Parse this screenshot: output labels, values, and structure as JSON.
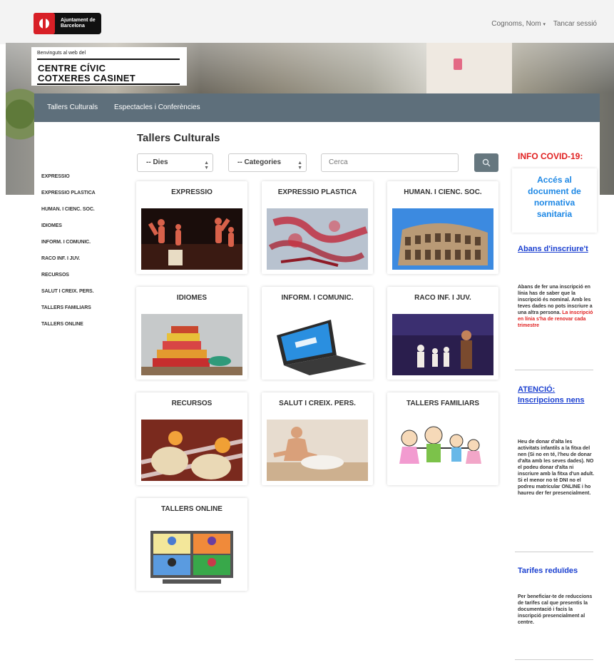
{
  "header": {
    "logo_text": [
      "Ajuntament de",
      "Barcelona"
    ],
    "user_menu": "Cognoms, Nom",
    "logout": "Tancar sessió"
  },
  "hero": {
    "welcome": "Benvinguts al web del",
    "name_line1": "CENTRE CÍVIC",
    "name_line2": "COTXERES CASINET"
  },
  "nav": {
    "items": [
      "Tallers Culturals",
      "Espectacles i Conferències"
    ]
  },
  "main": {
    "title": "Tallers Culturals",
    "filters": {
      "days": "-- Dies",
      "categories": "-- Categories",
      "search_placeholder": "Cerca"
    }
  },
  "sidebar": {
    "items": [
      "EXPRESSIO",
      "EXPRESSIO PLASTICA",
      "HUMAN. I CIENC. SOC.",
      "IDIOMES",
      "INFORM. I COMUNIC.",
      "RACO INF. I JUV.",
      "RECURSOS",
      "SALUT I CREIX. PERS.",
      "TALLERS FAMILIARS",
      "TALLERS ONLINE"
    ]
  },
  "cards": [
    {
      "title": "EXPRESSIO",
      "image": "dance-performance-image"
    },
    {
      "title": "EXPRESSIO PLASTICA",
      "image": "red-paint-image"
    },
    {
      "title": "HUMAN. I CIENC. SOC.",
      "image": "colosseum-image"
    },
    {
      "title": "IDIOMES",
      "image": "stacked-books-image"
    },
    {
      "title": "INFORM. I COMUNIC.",
      "image": "laptop-image"
    },
    {
      "title": "RACO INF. I JUV.",
      "image": "kids-on-stage-image"
    },
    {
      "title": "RECURSOS",
      "image": "dumplings-image"
    },
    {
      "title": "SALUT I CREIX. PERS.",
      "image": "meditation-image"
    },
    {
      "title": "TALLERS FAMILIARS",
      "image": "family-drawing-image"
    },
    {
      "title": "TALLERS ONLINE",
      "image": "video-call-image"
    }
  ],
  "right": {
    "covid_title": "INFO COVID-19:",
    "covid_link": "Accés al document de normativa sanitaria",
    "before_title": "Abans d'inscriure't",
    "before_text": "Abans de fer una inscripció en línia has de saber que la inscripció és nominal. Amb les teves dades no pots inscriure a una altra persona.",
    "before_warning": "La inscripció en línia s'ha de renovar cada trimestre",
    "attention_title": "ATENCIÓ: Inscripcions nens",
    "attention_text": "Heu de donar d'alta les activitats infantils a la fitxa del nen (Si no en té, l'heu de donar d'alta amb les seves dades). NO el podeu donar d'alta ni inscriure amb la fitxa d'un adult. Si el menor no té DNI no el podreu matricular ONLINE i ho haureu der fer presencialment.",
    "rates_title": "Tarifes reduïdes",
    "rates_text": "Per beneficiar-te de reduccions de tarifes cal que presentis la documentació i facis la inscripció presencialment al centre."
  },
  "colors": {
    "nav_bg": "#5e6f7b",
    "accent_red": "#e02020",
    "link_blue": "#1e88e5",
    "heading_blue": "#1a3fd0"
  }
}
